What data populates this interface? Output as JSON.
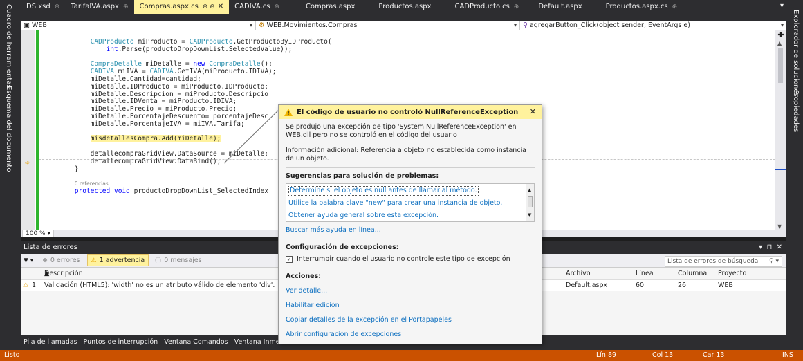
{
  "side_left": [
    "Cuadro de herramientas",
    "Esquema del documento"
  ],
  "side_right": [
    "Explorador de soluciones",
    "Propiedades"
  ],
  "tabs": [
    {
      "label": "DS.xsd",
      "pin": "⊕"
    },
    {
      "label": "TarifaIVA.aspx",
      "pin": "⊕"
    },
    {
      "label": "Compras.aspx.cs",
      "pin": "⊕ ⊖",
      "active": true
    },
    {
      "label": "CADIVA.cs",
      "pin": "⊕"
    },
    {
      "label": "Compras.aspx",
      "pin": ""
    },
    {
      "label": "Productos.aspx",
      "pin": ""
    },
    {
      "label": "CADProducto.cs",
      "pin": "⊕"
    },
    {
      "label": "Default.aspx",
      "pin": ""
    },
    {
      "label": "Productos.aspx.cs",
      "pin": "⊕"
    }
  ],
  "navbar": {
    "project": "WEB",
    "class": "WEB.Movimientos.Compras",
    "member": "agregarButton_Click(object sender, EventArgs e)"
  },
  "code_lines": [
    {
      "segs": [
        {
          "t": "            "
        },
        {
          "t": "CADProducto",
          "c": "ty"
        },
        {
          "t": " miProducto = "
        },
        {
          "t": "CADProducto",
          "c": "ty"
        },
        {
          "t": ".GetProductoByIDProducto("
        }
      ]
    },
    {
      "segs": [
        {
          "t": "                "
        },
        {
          "t": "int",
          "c": "kw"
        },
        {
          "t": ".Parse(productoDropDownList.SelectedValue));"
        }
      ]
    },
    {
      "segs": [
        {
          "t": ""
        }
      ]
    },
    {
      "segs": [
        {
          "t": "            "
        },
        {
          "t": "CompraDetalle",
          "c": "ty"
        },
        {
          "t": " miDetalle = "
        },
        {
          "t": "new",
          "c": "kw"
        },
        {
          "t": " "
        },
        {
          "t": "CompraDetalle",
          "c": "ty"
        },
        {
          "t": "();"
        }
      ]
    },
    {
      "segs": [
        {
          "t": "            "
        },
        {
          "t": "CADIVA",
          "c": "ty"
        },
        {
          "t": " miIVA = "
        },
        {
          "t": "CADIVA",
          "c": "ty"
        },
        {
          "t": ".GetIVA(miProducto.IDIVA);"
        }
      ]
    },
    {
      "segs": [
        {
          "t": "            miDetalle.Cantidad=cantidad;"
        }
      ]
    },
    {
      "segs": [
        {
          "t": "            miDetalle.IDProducto = miProducto.IDProducto;"
        }
      ]
    },
    {
      "segs": [
        {
          "t": "            miDetalle.Descripcion = miProducto.Descripcio"
        }
      ]
    },
    {
      "segs": [
        {
          "t": "            miDetalle.IDVenta = miProducto.IDIVA;"
        }
      ]
    },
    {
      "segs": [
        {
          "t": "            miDetalle.Precio = miProducto.Precio;"
        }
      ]
    },
    {
      "segs": [
        {
          "t": "            miDetalle.PorcentajeDescuento= porcentajeDesc"
        }
      ]
    },
    {
      "segs": [
        {
          "t": "            miDetalle.PorcentajeIVA = miIVA.Tarifa;"
        }
      ]
    },
    {
      "segs": [
        {
          "t": ""
        }
      ]
    },
    {
      "segs": [
        {
          "t": "            "
        },
        {
          "t": "misdetallesCompra.Add(miDetalle);",
          "c": "hl"
        }
      ]
    },
    {
      "segs": [
        {
          "t": ""
        }
      ]
    },
    {
      "segs": [
        {
          "t": "            detallecompraGridView.DataSource = miDetalle;"
        }
      ]
    },
    {
      "segs": [
        {
          "t": "            detallecompraGridView.DataBind();"
        }
      ]
    },
    {
      "segs": [
        {
          "t": "        }"
        }
      ]
    },
    {
      "segs": [
        {
          "t": ""
        }
      ]
    },
    {
      "segs": [
        {
          "t": "        "
        },
        {
          "t": "0 referencias",
          "c": "cm"
        }
      ]
    },
    {
      "segs": [
        {
          "t": "        "
        },
        {
          "t": "protected",
          "c": "kw"
        },
        {
          "t": " "
        },
        {
          "t": "void",
          "c": "kw"
        },
        {
          "t": " productoDropDownList_SelectedIndex"
        }
      ]
    }
  ],
  "zoom": "100 %",
  "errorlist": {
    "title": "Lista de errores",
    "errors": "0 errores",
    "warnings": "1 advertencia",
    "messages": "0 mensajes",
    "search_placeholder": "Lista de errores de búsqueda",
    "columns": {
      "desc": "Descripción",
      "file": "Archivo",
      "line": "Línea",
      "col": "Columna",
      "project": "Proyecto"
    },
    "rows": [
      {
        "n": "1",
        "desc": "Validación (HTML5): 'width' no es un atributo válido de elemento 'div'.",
        "file": "Default.aspx",
        "line": "60",
        "col": "26",
        "project": "WEB"
      }
    ]
  },
  "bottom_tabs": [
    "Pila de llamadas",
    "Puntos de interrupción",
    "Ventana Comandos",
    "Ventana Inmediat"
  ],
  "status": {
    "left": "Listo",
    "line": "Lín 89",
    "col": "Col 13",
    "car": "Car 13",
    "ins": "INS"
  },
  "popup": {
    "title": "El código de usuario no controló NullReferenceException",
    "body1": "Se produjo una excepción de tipo 'System.NullReferenceException' en WEB.dll pero no se controló en el código del usuario",
    "body2": "Información adicional: Referencia a objeto no establecida como instancia de un objeto.",
    "suggestions_title": "Sugerencias para solución de problemas:",
    "suggestions": [
      "Determine si el objeto es null antes de llamar al método.",
      "Utilice la palabra clave \"new\" para crear una instancia de objeto.",
      "Obtener ayuda general sobre esta excepción."
    ],
    "more_help": "Buscar más ayuda en línea...",
    "config_title": "Configuración de excepciones:",
    "config_check": "Interrumpir cuando el usuario no controle este tipo de excepción",
    "actions_title": "Acciones:",
    "actions": [
      "Ver detalle...",
      "Habilitar edición",
      "Copiar detalles de la excepción en el Portapapeles",
      "Abrir configuración de excepciones"
    ]
  },
  "colors": {
    "accent": "#ca5100",
    "highlight": "#fff29d",
    "link": "#0e70c0",
    "dark": "#2d2d30"
  }
}
